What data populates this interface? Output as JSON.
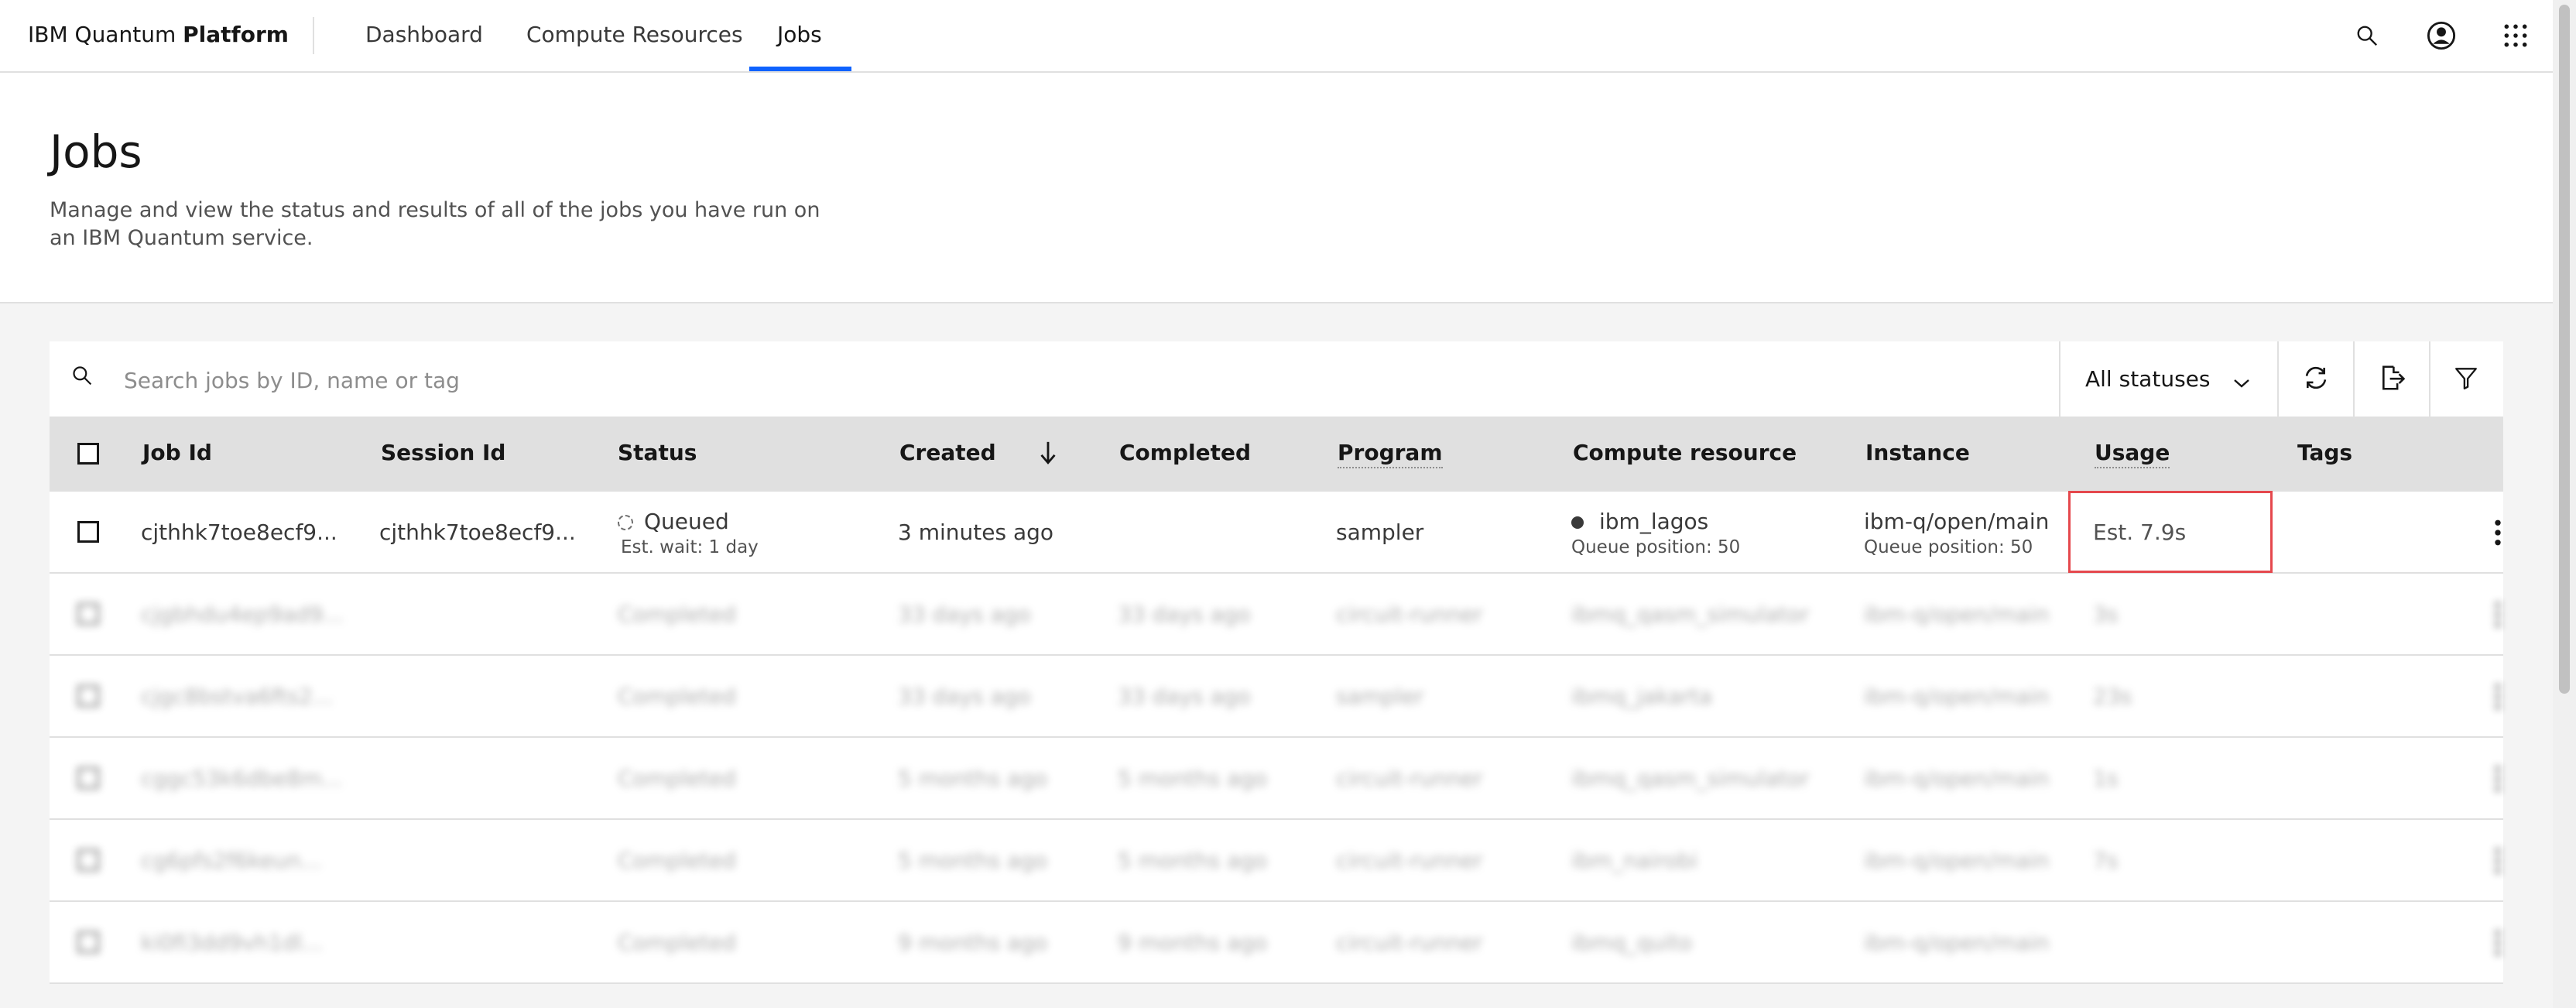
{
  "header": {
    "brand_prefix": "IBM Quantum ",
    "brand_bold": "Platform",
    "nav": [
      {
        "label": "Dashboard"
      },
      {
        "label": "Compute Resources"
      },
      {
        "label": "Jobs",
        "active": true
      }
    ]
  },
  "page": {
    "title": "Jobs",
    "description": "Manage and view the status and results of all of the jobs you have run on an IBM Quantum service."
  },
  "toolbar": {
    "search_placeholder": "Search jobs by ID, name or tag",
    "status_filter": "All statuses"
  },
  "table": {
    "columns": [
      "Job Id",
      "Session Id",
      "Status",
      "Created",
      "Completed",
      "Program",
      "Compute resource",
      "Instance",
      "Usage",
      "Tags"
    ],
    "rows": [
      {
        "job_id": "cjthhk7toe8ecf9...",
        "session_id": "cjthhk7toe8ecf9...",
        "status": "Queued",
        "status_sub": "Est. wait: 1 day",
        "created": "3 minutes ago",
        "completed": "",
        "program": "sampler",
        "compute_resource": "ibm_lagos",
        "compute_sub": "Queue position: 50",
        "instance": "ibm-q/open/main",
        "instance_sub": "Queue position: 50",
        "usage": "Est. 7.9s"
      },
      {
        "job_id": "cjgbhdu4ep9ad9...",
        "session_id": "",
        "status": "Completed",
        "created": "33 days ago",
        "completed": "33 days ago",
        "program": "circuit-runner",
        "compute_resource": "ibmq_qasm_simulator",
        "instance": "ibm-q/open/main",
        "usage": "3s"
      },
      {
        "job_id": "cjgc8bstva6fts2...",
        "session_id": "",
        "status": "Completed",
        "created": "33 days ago",
        "completed": "33 days ago",
        "program": "sampler",
        "compute_resource": "ibmq_jakarta",
        "instance": "ibm-q/open/main",
        "usage": "23s"
      },
      {
        "job_id": "cggc53k6dbe8m...",
        "session_id": "",
        "status": "Completed",
        "created": "5 months ago",
        "completed": "5 months ago",
        "program": "circuit-runner",
        "compute_resource": "ibmq_qasm_simulator",
        "instance": "ibm-q/open/main",
        "usage": "1s"
      },
      {
        "job_id": "cg6pfs2f6keun...",
        "session_id": "",
        "status": "Completed",
        "created": "5 months ago",
        "completed": "5 months ago",
        "program": "circuit-runner",
        "compute_resource": "ibm_nairobi",
        "instance": "ibm-q/open/main",
        "usage": "7s"
      },
      {
        "job_id": "ki0fi3dd9vh1dl...",
        "session_id": "",
        "status": "Completed",
        "created": "9 months ago",
        "completed": "9 months ago",
        "program": "circuit-runner",
        "compute_resource": "ibmq_quito",
        "instance": "ibm-q/open/main",
        "usage": ""
      }
    ]
  },
  "colors": {
    "accent": "#0f62fe",
    "highlight": "#e5484d",
    "header_row": "#e0e0e0",
    "background": "#f4f4f4"
  },
  "icons": [
    "search-icon",
    "user-avatar-icon",
    "app-switcher-icon",
    "chevron-down-icon",
    "refresh-icon",
    "export-icon",
    "filter-icon",
    "sort-arrow-down-icon",
    "overflow-menu-icon",
    "queued-status-icon"
  ]
}
